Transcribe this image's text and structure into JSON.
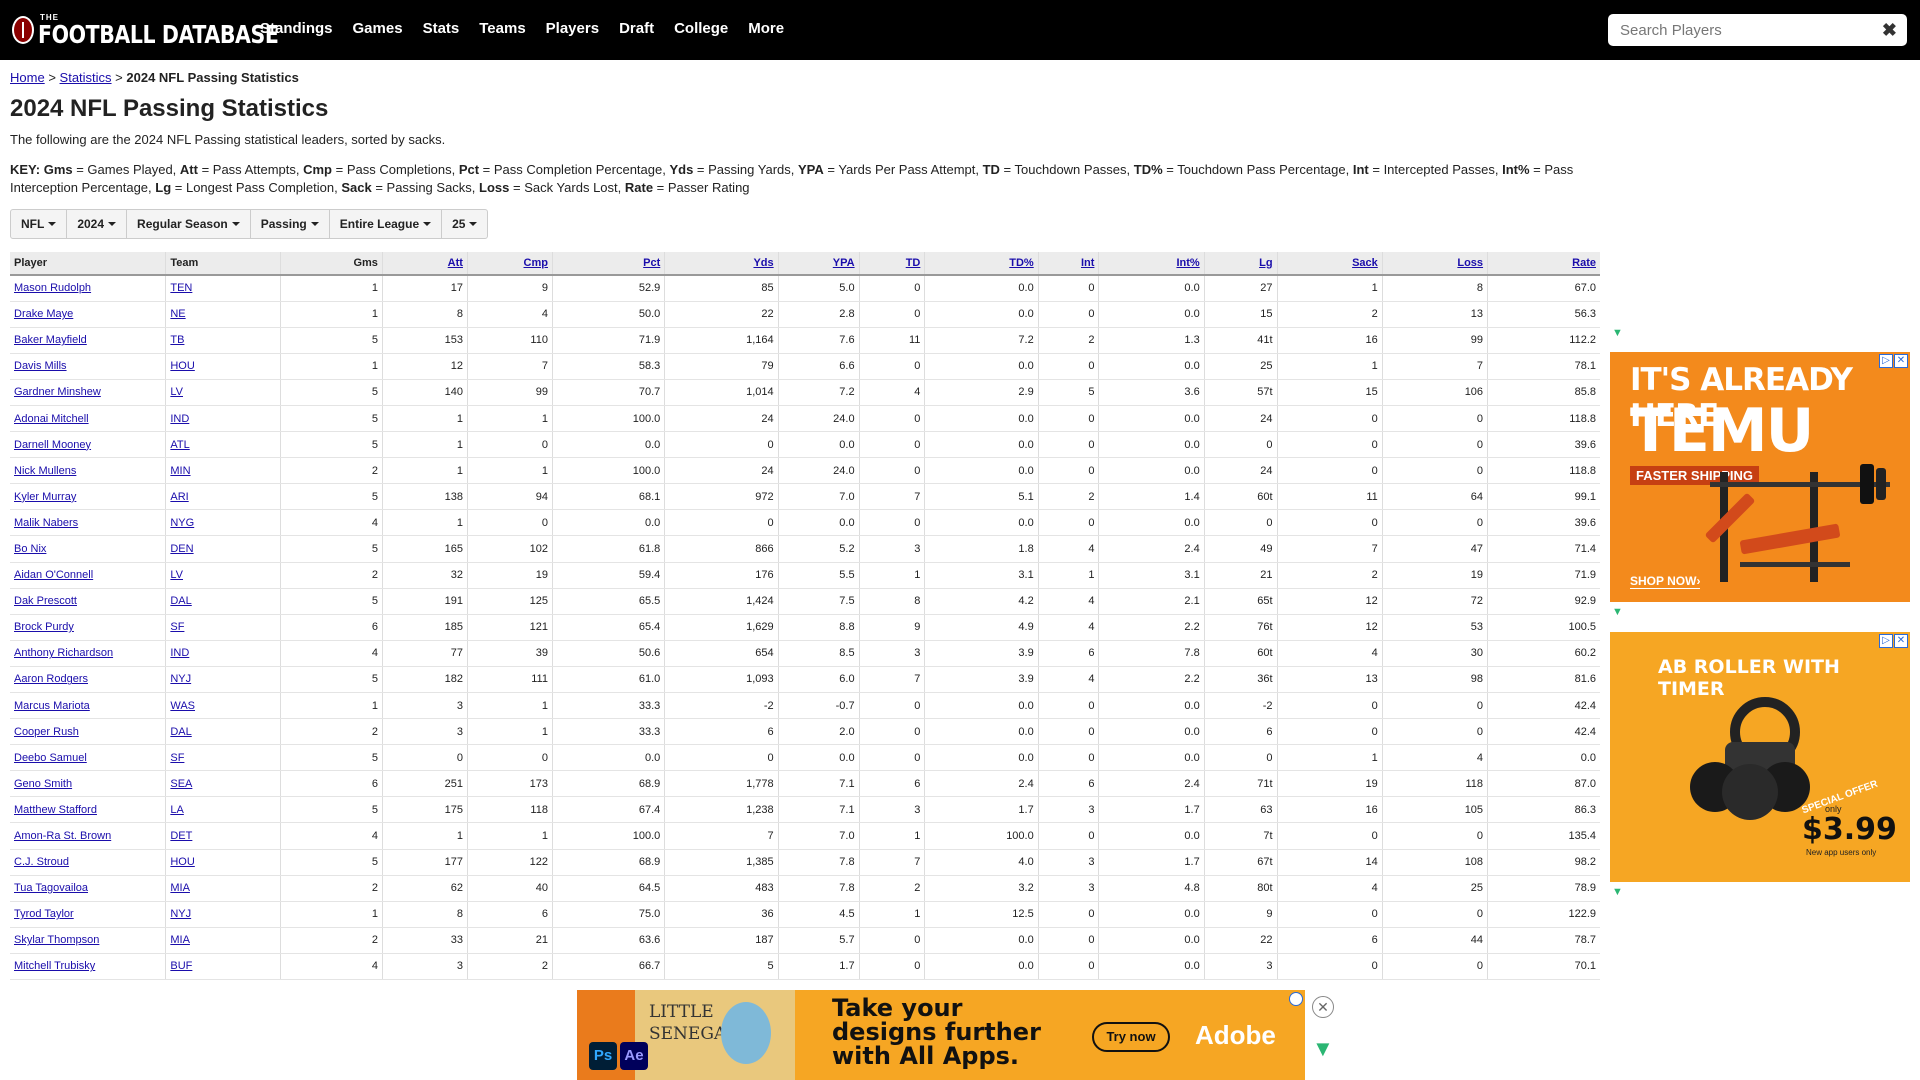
{
  "logo": {
    "small": "THE",
    "big": "FOOTBALL DATABASE"
  },
  "nav": [
    "Standings",
    "Games",
    "Stats",
    "Teams",
    "Players",
    "Draft",
    "College",
    "More"
  ],
  "search": {
    "placeholder": "Search Players",
    "clear": "✖"
  },
  "breadcrumb": {
    "home": "Home",
    "sep": ">",
    "stats": "Statistics",
    "current": "2024 NFL Passing Statistics"
  },
  "title": "2024 NFL Passing Statistics",
  "description": "The following are the 2024 NFL Passing statistical leaders, sorted by sacks.",
  "key": [
    [
      "KEY: Gms",
      " = Games Played, "
    ],
    [
      "Att",
      " = Pass Attempts, "
    ],
    [
      "Cmp",
      " = Pass Completions, "
    ],
    [
      "Pct",
      " = Pass Completion Percentage, "
    ],
    [
      "Yds",
      " = Passing Yards, "
    ],
    [
      "YPA",
      " = Yards Per Pass Attempt, "
    ],
    [
      "TD",
      " = Touchdown Passes, "
    ],
    [
      "TD%",
      " = Touchdown Pass Percentage, "
    ],
    [
      "Int",
      " = Intercepted Passes, "
    ],
    [
      "Int%",
      " = Pass Interception Percentage, "
    ],
    [
      "Lg",
      " = Longest Pass Completion, "
    ],
    [
      "Sack",
      " = Passing Sacks, "
    ],
    [
      "Loss",
      " = Sack Yards Lost, "
    ],
    [
      "Rate",
      " = Passer Rating"
    ]
  ],
  "filters": [
    "NFL",
    "2024",
    "Regular Season",
    "Passing",
    "Entire League",
    "25"
  ],
  "table": {
    "headers": [
      "Player",
      "Team",
      "Gms",
      "Att",
      "Cmp",
      "Pct",
      "Yds",
      "YPA",
      "TD",
      "TD%",
      "Int",
      "Int%",
      "Lg",
      "Sack",
      "Loss",
      "Rate"
    ],
    "rows": [
      [
        "Mason Rudolph",
        "TEN",
        "1",
        "17",
        "9",
        "52.9",
        "85",
        "5.0",
        "0",
        "0.0",
        "0",
        "0.0",
        "27",
        "1",
        "8",
        "67.0"
      ],
      [
        "Drake Maye",
        "NE",
        "1",
        "8",
        "4",
        "50.0",
        "22",
        "2.8",
        "0",
        "0.0",
        "0",
        "0.0",
        "15",
        "2",
        "13",
        "56.3"
      ],
      [
        "Baker Mayfield",
        "TB",
        "5",
        "153",
        "110",
        "71.9",
        "1,164",
        "7.6",
        "11",
        "7.2",
        "2",
        "1.3",
        "41t",
        "16",
        "99",
        "112.2"
      ],
      [
        "Davis Mills",
        "HOU",
        "1",
        "12",
        "7",
        "58.3",
        "79",
        "6.6",
        "0",
        "0.0",
        "0",
        "0.0",
        "25",
        "1",
        "7",
        "78.1"
      ],
      [
        "Gardner Minshew",
        "LV",
        "5",
        "140",
        "99",
        "70.7",
        "1,014",
        "7.2",
        "4",
        "2.9",
        "5",
        "3.6",
        "57t",
        "15",
        "106",
        "85.8"
      ],
      [
        "Adonai Mitchell",
        "IND",
        "5",
        "1",
        "1",
        "100.0",
        "24",
        "24.0",
        "0",
        "0.0",
        "0",
        "0.0",
        "24",
        "0",
        "0",
        "118.8"
      ],
      [
        "Darnell Mooney",
        "ATL",
        "5",
        "1",
        "0",
        "0.0",
        "0",
        "0.0",
        "0",
        "0.0",
        "0",
        "0.0",
        "0",
        "0",
        "0",
        "39.6"
      ],
      [
        "Nick Mullens",
        "MIN",
        "2",
        "1",
        "1",
        "100.0",
        "24",
        "24.0",
        "0",
        "0.0",
        "0",
        "0.0",
        "24",
        "0",
        "0",
        "118.8"
      ],
      [
        "Kyler Murray",
        "ARI",
        "5",
        "138",
        "94",
        "68.1",
        "972",
        "7.0",
        "7",
        "5.1",
        "2",
        "1.4",
        "60t",
        "11",
        "64",
        "99.1"
      ],
      [
        "Malik Nabers",
        "NYG",
        "4",
        "1",
        "0",
        "0.0",
        "0",
        "0.0",
        "0",
        "0.0",
        "0",
        "0.0",
        "0",
        "0",
        "0",
        "39.6"
      ],
      [
        "Bo Nix",
        "DEN",
        "5",
        "165",
        "102",
        "61.8",
        "866",
        "5.2",
        "3",
        "1.8",
        "4",
        "2.4",
        "49",
        "7",
        "47",
        "71.4"
      ],
      [
        "Aidan O'Connell",
        "LV",
        "2",
        "32",
        "19",
        "59.4",
        "176",
        "5.5",
        "1",
        "3.1",
        "1",
        "3.1",
        "21",
        "2",
        "19",
        "71.9"
      ],
      [
        "Dak Prescott",
        "DAL",
        "5",
        "191",
        "125",
        "65.5",
        "1,424",
        "7.5",
        "8",
        "4.2",
        "4",
        "2.1",
        "65t",
        "12",
        "72",
        "92.9"
      ],
      [
        "Brock Purdy",
        "SF",
        "6",
        "185",
        "121",
        "65.4",
        "1,629",
        "8.8",
        "9",
        "4.9",
        "4",
        "2.2",
        "76t",
        "12",
        "53",
        "100.5"
      ],
      [
        "Anthony Richardson",
        "IND",
        "4",
        "77",
        "39",
        "50.6",
        "654",
        "8.5",
        "3",
        "3.9",
        "6",
        "7.8",
        "60t",
        "4",
        "30",
        "60.2"
      ],
      [
        "Aaron Rodgers",
        "NYJ",
        "5",
        "182",
        "111",
        "61.0",
        "1,093",
        "6.0",
        "7",
        "3.9",
        "4",
        "2.2",
        "36t",
        "13",
        "98",
        "81.6"
      ],
      [
        "Marcus Mariota",
        "WAS",
        "1",
        "3",
        "1",
        "33.3",
        "-2",
        "-0.7",
        "0",
        "0.0",
        "0",
        "0.0",
        "-2",
        "0",
        "0",
        "42.4"
      ],
      [
        "Cooper Rush",
        "DAL",
        "2",
        "3",
        "1",
        "33.3",
        "6",
        "2.0",
        "0",
        "0.0",
        "0",
        "0.0",
        "6",
        "0",
        "0",
        "42.4"
      ],
      [
        "Deebo Samuel",
        "SF",
        "5",
        "0",
        "0",
        "0.0",
        "0",
        "0.0",
        "0",
        "0.0",
        "0",
        "0.0",
        "0",
        "1",
        "4",
        "0.0"
      ],
      [
        "Geno Smith",
        "SEA",
        "6",
        "251",
        "173",
        "68.9",
        "1,778",
        "7.1",
        "6",
        "2.4",
        "6",
        "2.4",
        "71t",
        "19",
        "118",
        "87.0"
      ],
      [
        "Matthew Stafford",
        "LA",
        "5",
        "175",
        "118",
        "67.4",
        "1,238",
        "7.1",
        "3",
        "1.7",
        "3",
        "1.7",
        "63",
        "16",
        "105",
        "86.3"
      ],
      [
        "Amon-Ra St. Brown",
        "DET",
        "4",
        "1",
        "1",
        "100.0",
        "7",
        "7.0",
        "1",
        "100.0",
        "0",
        "0.0",
        "7t",
        "0",
        "0",
        "135.4"
      ],
      [
        "C.J. Stroud",
        "HOU",
        "5",
        "177",
        "122",
        "68.9",
        "1,385",
        "7.8",
        "7",
        "4.0",
        "3",
        "1.7",
        "67t",
        "14",
        "108",
        "98.2"
      ],
      [
        "Tua Tagovailoa",
        "MIA",
        "2",
        "62",
        "40",
        "64.5",
        "483",
        "7.8",
        "2",
        "3.2",
        "3",
        "4.8",
        "80t",
        "4",
        "25",
        "78.9"
      ],
      [
        "Tyrod Taylor",
        "NYJ",
        "1",
        "8",
        "6",
        "75.0",
        "36",
        "4.5",
        "1",
        "12.5",
        "0",
        "0.0",
        "9",
        "0",
        "0",
        "122.9"
      ],
      [
        "Skylar Thompson",
        "MIA",
        "2",
        "33",
        "21",
        "63.6",
        "187",
        "5.7",
        "0",
        "0.0",
        "0",
        "0.0",
        "22",
        "6",
        "44",
        "78.7"
      ],
      [
        "Mitchell Trubisky",
        "BUF",
        "4",
        "3",
        "2",
        "66.7",
        "5",
        "1.7",
        "0",
        "0.0",
        "0",
        "0.0",
        "3",
        "0",
        "0",
        "70.1"
      ]
    ]
  },
  "ads": {
    "temu": {
      "line1": "IT'S ALREADY HERE",
      "line2": "TEMU",
      "tag": "FASTER SHIPPING",
      "cta": "SHOP NOW›"
    },
    "abroller": {
      "title": "AB ROLLER WITH TIMER",
      "offer": "SPECIAL OFFER",
      "only": "only",
      "price": "$3.99",
      "note": "New app users only"
    },
    "adobe": {
      "poster1": "LITTLE",
      "poster2": "SENEGAL",
      "ps": "Ps",
      "ae": "Ae",
      "headline1": "Take your",
      "headline2": "designs further",
      "headline3": "with All Apps.",
      "cta": "Try now",
      "brand": "Adobe"
    }
  }
}
